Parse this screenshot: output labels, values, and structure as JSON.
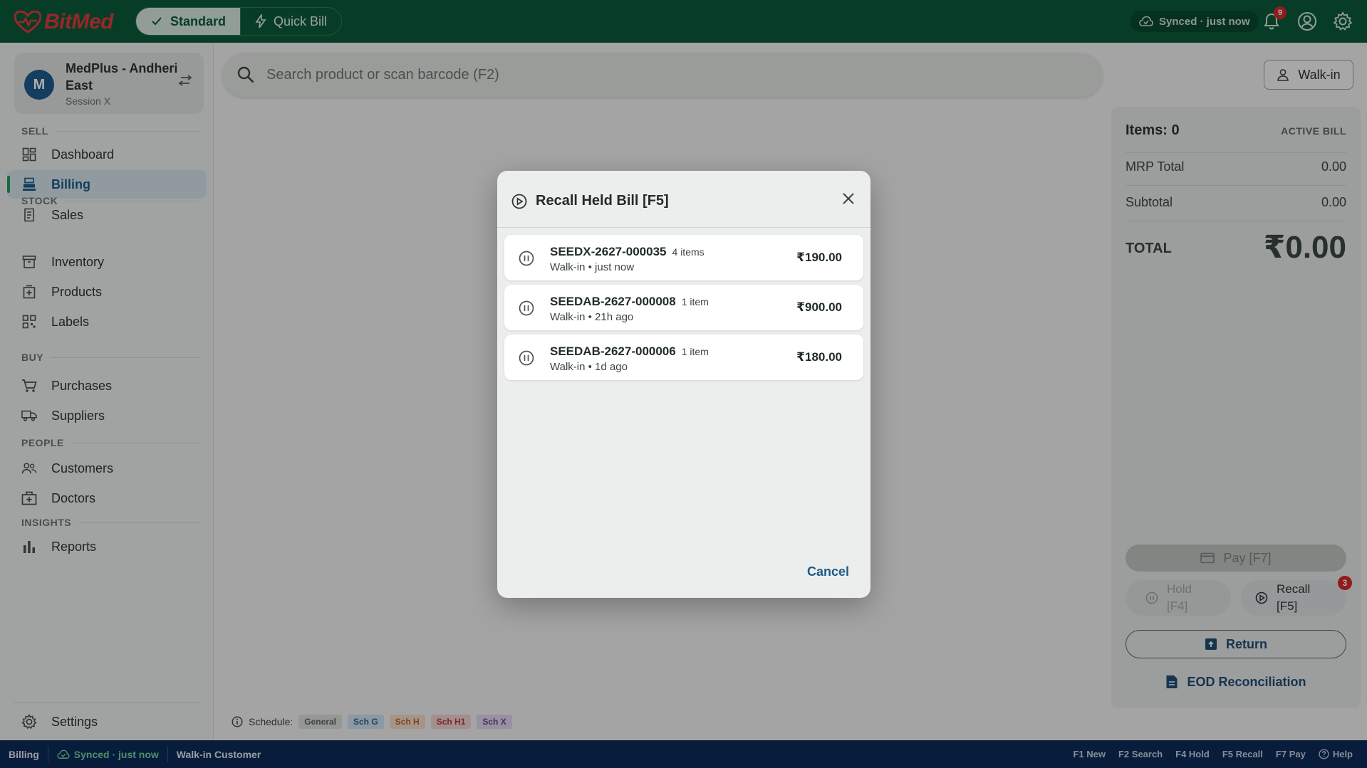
{
  "app": {
    "logo": "BitMed",
    "modes": [
      "Standard",
      "Quick Bill"
    ],
    "sync_status": "Synced · just now",
    "notification_count": "9"
  },
  "store": {
    "avatar_letter": "M",
    "name": "MedPlus - Andheri East",
    "session": "Session X"
  },
  "nav": {
    "sections": {
      "sell": "SELL",
      "stock": "STOCK",
      "buy": "BUY",
      "people": "PEOPLE",
      "insights": "INSIGHTS"
    },
    "items": {
      "dashboard": "Dashboard",
      "billing": "Billing",
      "sales": "Sales",
      "inventory": "Inventory",
      "products": "Products",
      "labels": "Labels",
      "purchases": "Purchases",
      "suppliers": "Suppliers",
      "customers": "Customers",
      "doctors": "Doctors",
      "reports": "Reports",
      "settings": "Settings"
    }
  },
  "search": {
    "placeholder": "Search product or scan barcode (F2)"
  },
  "customer_button": "Walk-in",
  "bill": {
    "items_label": "Items: 0",
    "active_label": "ACTIVE BILL",
    "mrp_total_label": "MRP Total",
    "mrp_total_value": "0.00",
    "subtotal_label": "Subtotal",
    "subtotal_value": "0.00",
    "total_label": "TOTAL",
    "total_value": "₹0.00",
    "pay_label": "Pay  [F7]",
    "hold_line1": "Hold",
    "hold_line2": "[F4]",
    "recall_line1": "Recall",
    "recall_line2": "[F5]",
    "recall_badge": "3",
    "return_label": "Return",
    "eod_label": "EOD Reconciliation"
  },
  "schedule": {
    "label": "Schedule:",
    "chips": [
      {
        "label": "General",
        "bg": "#dcdedd",
        "fg": "#5b6560"
      },
      {
        "label": "Sch G",
        "bg": "#cfe0ef",
        "fg": "#2f6390"
      },
      {
        "label": "Sch H",
        "bg": "#f4dccb",
        "fg": "#b8652a"
      },
      {
        "label": "Sch H1",
        "bg": "#f2d3d3",
        "fg": "#b63a3a"
      },
      {
        "label": "Sch X",
        "bg": "#e0d6ec",
        "fg": "#6b4896"
      }
    ]
  },
  "statusbar": {
    "page": "Billing",
    "sync": "Synced · just now",
    "customer": "Walk-in Customer",
    "shortcuts": [
      "F1 New",
      "F2 Search",
      "F4 Hold",
      "F5 Recall",
      "F7 Pay"
    ],
    "help": "Help"
  },
  "modal": {
    "title": "Recall Held Bill  [F5]",
    "held_bills": [
      {
        "id": "SEEDX-2627-000035",
        "count": "4 items",
        "meta": "Walk-in • just now",
        "amount": "₹190.00"
      },
      {
        "id": "SEEDAB-2627-000008",
        "count": "1 item",
        "meta": "Walk-in • 21h ago",
        "amount": "₹900.00"
      },
      {
        "id": "SEEDAB-2627-000006",
        "count": "1 item",
        "meta": "Walk-in • 1d ago",
        "amount": "₹180.00"
      }
    ],
    "cancel_label": "Cancel"
  },
  "colors": {
    "topbar": "#0b5a39",
    "statusbar": "#0c2a57",
    "accent_blue": "#1d5c86",
    "badge_red": "#d62a2a"
  }
}
